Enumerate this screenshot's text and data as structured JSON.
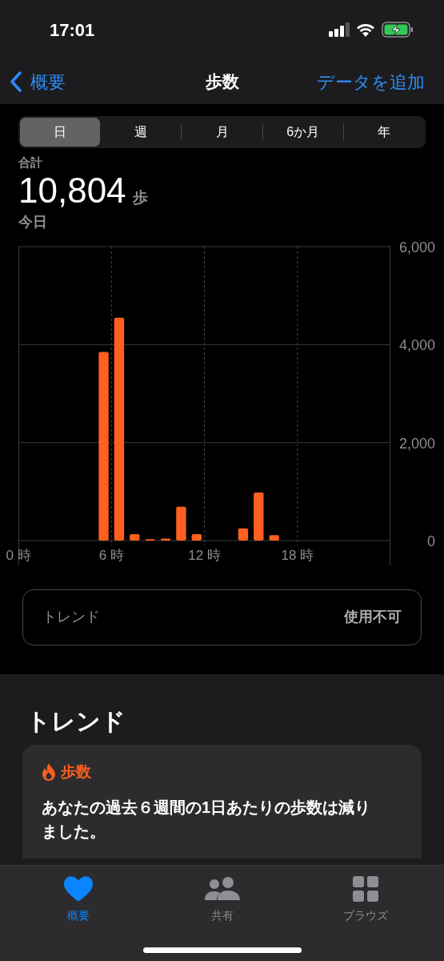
{
  "status_bar": {
    "time": "17:01"
  },
  "nav": {
    "back": "概要",
    "title": "歩数",
    "action": "データを追加"
  },
  "segments": [
    {
      "label": "日",
      "selected": true
    },
    {
      "label": "週",
      "selected": false
    },
    {
      "label": "月",
      "selected": false
    },
    {
      "label": "6か月",
      "selected": false
    },
    {
      "label": "年",
      "selected": false
    }
  ],
  "summary": {
    "label": "合計",
    "value": "10,804",
    "unit": "歩",
    "date": "今日"
  },
  "chart": {
    "chart_data": {
      "type": "bar",
      "x": [
        0.5,
        1.5,
        2.5,
        3.5,
        4.5,
        5.5,
        6.5,
        7.5,
        8.5,
        9.5,
        10.5,
        11.5,
        12.5,
        13.5,
        14.5,
        15.5,
        16.5,
        17.5,
        18.5,
        19.5,
        20.5,
        21.5,
        22.5,
        23.5
      ],
      "grid": true,
      "series": [
        {
          "color": "#ff5f1f",
          "values": [
            0,
            0,
            0,
            0,
            0,
            3850,
            4550,
            130,
            30,
            40,
            690,
            130,
            0,
            0,
            250,
            980,
            110,
            0,
            0,
            0,
            0,
            0,
            0,
            0
          ]
        }
      ],
      "xlim": [
        0,
        24
      ],
      "ylim": [
        0,
        6000
      ],
      "xticks": [
        {
          "value": 0,
          "label": "0 時"
        },
        {
          "value": 6,
          "label": "6 時"
        },
        {
          "value": 12,
          "label": "12 時"
        },
        {
          "value": 18,
          "label": "18 時"
        }
      ],
      "yticks": [
        {
          "value": 0,
          "label": "0"
        },
        {
          "value": 2000,
          "label": "2,000"
        },
        {
          "value": 4000,
          "label": "4,000"
        },
        {
          "value": 6000,
          "label": "6,000"
        }
      ]
    }
  },
  "trend_row": {
    "label": "トレンド",
    "value": "使用不可"
  },
  "trends": {
    "heading": "トレンド",
    "card": {
      "title": "歩数",
      "text": "あなたの過去６週間の1日あたりの歩数は減りました。"
    }
  },
  "tab_bar": [
    {
      "label": "概要",
      "kind": "heart",
      "selected": true
    },
    {
      "label": "共有",
      "kind": "people",
      "selected": false
    },
    {
      "label": "ブラウズ",
      "kind": "grid",
      "selected": false
    }
  ]
}
